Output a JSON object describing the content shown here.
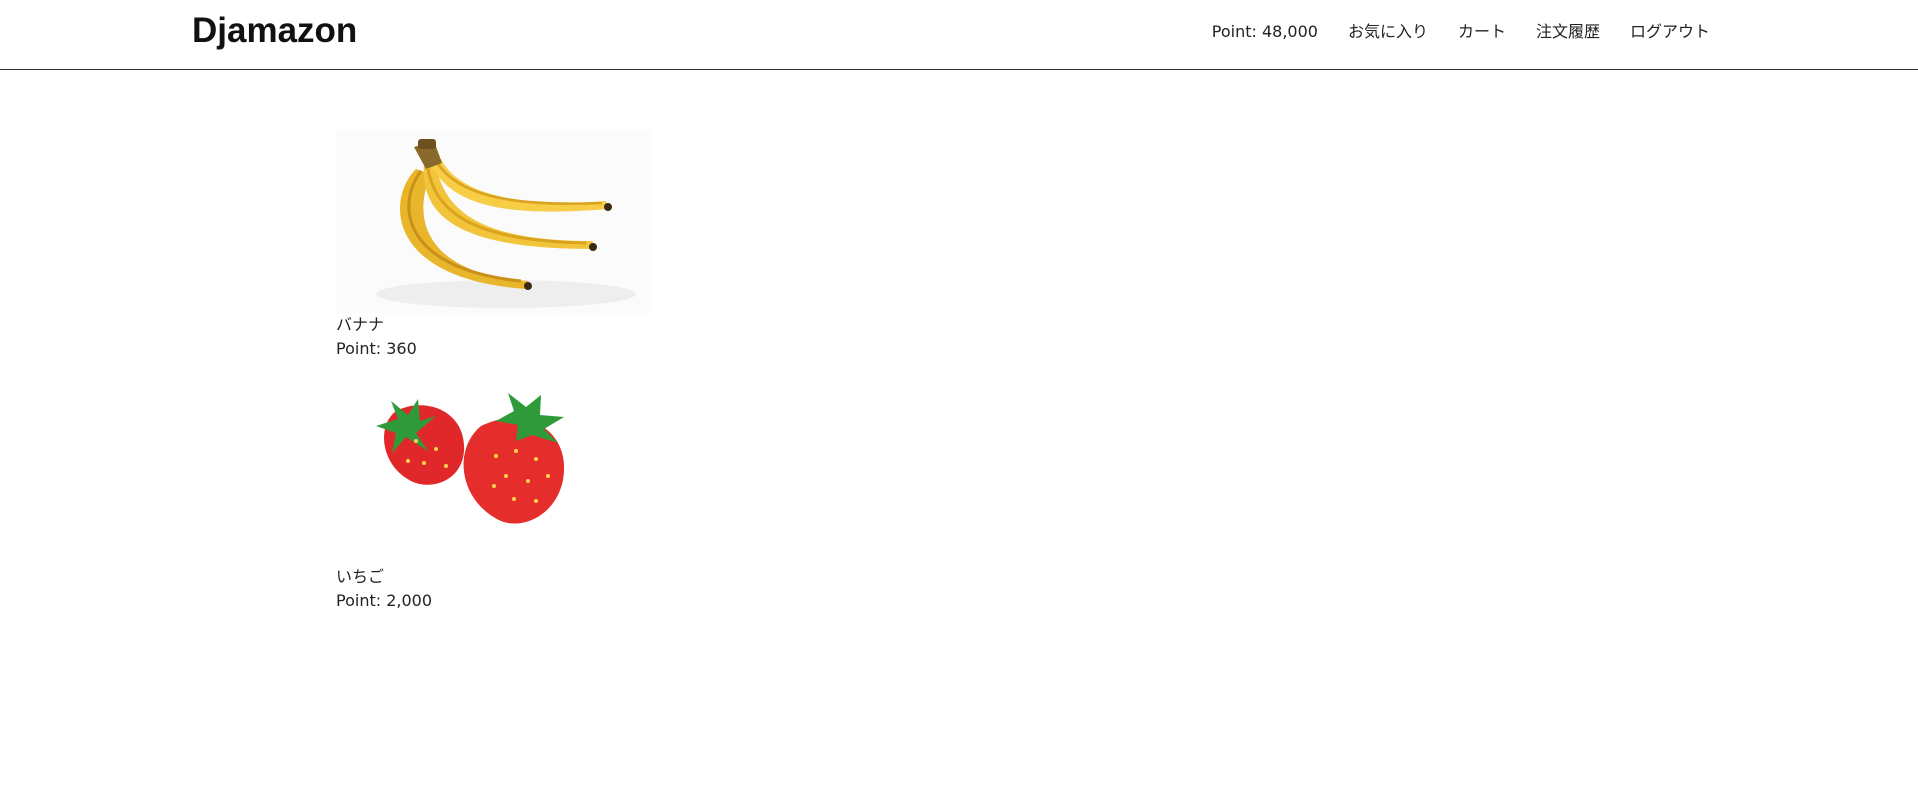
{
  "header": {
    "brand": "Djamazon",
    "points": "Point: 48,000",
    "nav": [
      {
        "label": "お気に入り"
      },
      {
        "label": "カート"
      },
      {
        "label": "注文履歴"
      },
      {
        "label": "ログアウト"
      }
    ]
  },
  "products": [
    {
      "name": "バナナ",
      "price": "Point: 360",
      "image": "banana-image"
    },
    {
      "name": "いちご",
      "price": "Point: 2,000",
      "image": "strawberry-image"
    }
  ],
  "colors": {
    "banana_yellow": "#f2c43a",
    "banana_shade": "#d9a21f",
    "strawberry_red": "#e0282a",
    "leaf_green": "#2f9a3a"
  }
}
